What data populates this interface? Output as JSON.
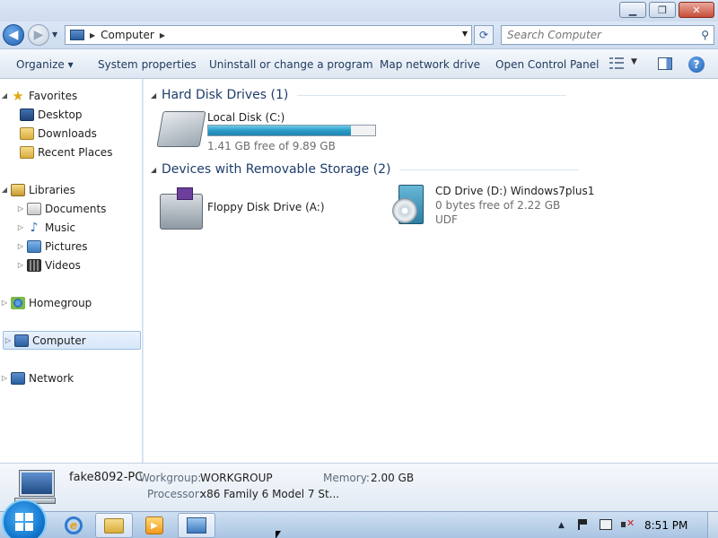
{
  "window": {
    "minimize_glyph": "▁",
    "maximize_glyph": "❐",
    "close_glyph": "✕"
  },
  "address": {
    "crumb": "Computer",
    "back_glyph": "◀",
    "forward_glyph": "▶",
    "refresh_glyph": "⟳",
    "search_placeholder": "Search Computer"
  },
  "toolbar": {
    "organize": "Organize ▾",
    "system_properties": "System properties",
    "uninstall": "Uninstall or change a program",
    "map_network_drive": "Map network drive",
    "open_control_panel": "Open Control Panel",
    "help_glyph": "?"
  },
  "sidebar": {
    "favorites": {
      "label": "Favorites",
      "icon": "star-icon"
    },
    "favorites_items": [
      {
        "label": "Desktop",
        "icon": "desktop-icon"
      },
      {
        "label": "Downloads",
        "icon": "downloads-icon"
      },
      {
        "label": "Recent Places",
        "icon": "recent-places-icon"
      }
    ],
    "libraries": {
      "label": "Libraries",
      "icon": "libraries-icon"
    },
    "libraries_items": [
      {
        "label": "Documents",
        "icon": "documents-icon"
      },
      {
        "label": "Music",
        "icon": "music-icon"
      },
      {
        "label": "Pictures",
        "icon": "pictures-icon"
      },
      {
        "label": "Videos",
        "icon": "videos-icon"
      }
    ],
    "homegroup": {
      "label": "Homegroup",
      "icon": "homegroup-icon"
    },
    "computer": {
      "label": "Computer",
      "icon": "computer-icon",
      "selected": true
    },
    "network": {
      "label": "Network",
      "icon": "network-icon"
    }
  },
  "content": {
    "groups": [
      {
        "title": "Hard Disk Drives (1)",
        "drives": [
          {
            "name": "Local Disk (C:)",
            "free_text": "1.41 GB free of 9.89 GB",
            "used_fraction": 0.857,
            "icon": "hard-disk-icon"
          }
        ]
      },
      {
        "title": "Devices with Removable Storage (2)",
        "drives": [
          {
            "name": "Floppy Disk Drive (A:)",
            "icon": "floppy-drive-icon"
          },
          {
            "name": "CD Drive (D:) Windows7plus1",
            "free_text": "0 bytes free of 2.22 GB",
            "filesystem": "UDF",
            "icon": "cd-drive-icon"
          }
        ]
      }
    ]
  },
  "details": {
    "computer_name": "fake8092-PC",
    "workgroup_label": "Workgroup:",
    "workgroup_value": "WORKGROUP",
    "memory_label": "Memory:",
    "memory_value": "2.00 GB",
    "processor_label": "Processor:",
    "processor_value": "x86 Family 6 Model 7 St..."
  },
  "taskbar": {
    "items": [
      "internet-explorer-icon",
      "windows-explorer-icon",
      "media-player-icon",
      "remote-desktop-icon"
    ],
    "tray_up_glyph": "▲",
    "clock": "8:51 PM"
  },
  "colors": {
    "capacity_bar": "#2a9bc7",
    "accent": "#1e3d6b"
  }
}
